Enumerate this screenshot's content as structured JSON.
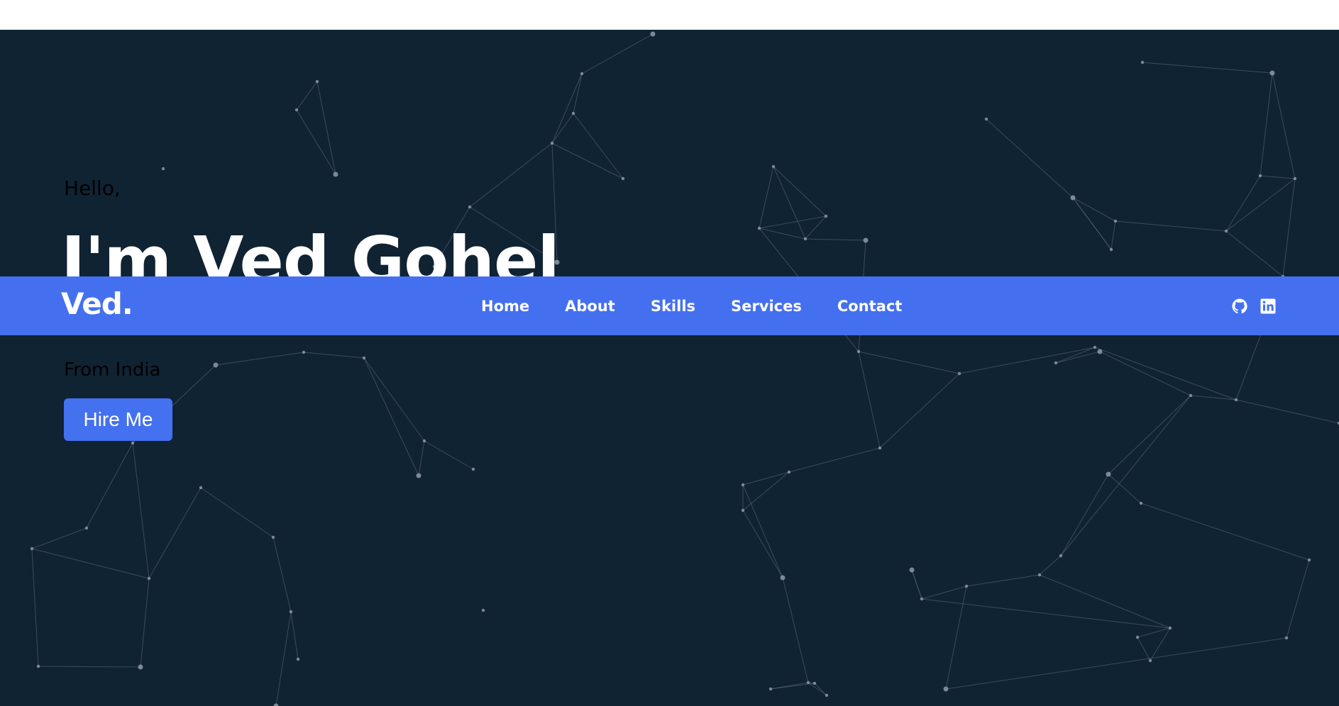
{
  "hero": {
    "greeting": "Hello,",
    "name": "I'm Ved Gohel",
    "location": "From India",
    "cta_label": "Hire Me"
  },
  "navbar": {
    "logo": "Ved.",
    "links": [
      {
        "label": "Home"
      },
      {
        "label": "About"
      },
      {
        "label": "Skills"
      },
      {
        "label": "Services"
      },
      {
        "label": "Contact"
      }
    ],
    "social": [
      {
        "icon": "github-icon"
      },
      {
        "icon": "linkedin-icon"
      }
    ]
  },
  "colors": {
    "hero_background": "#102333",
    "navbar_background": "#4470f0",
    "button_background": "#4471f0",
    "text_light": "#ffffff"
  }
}
